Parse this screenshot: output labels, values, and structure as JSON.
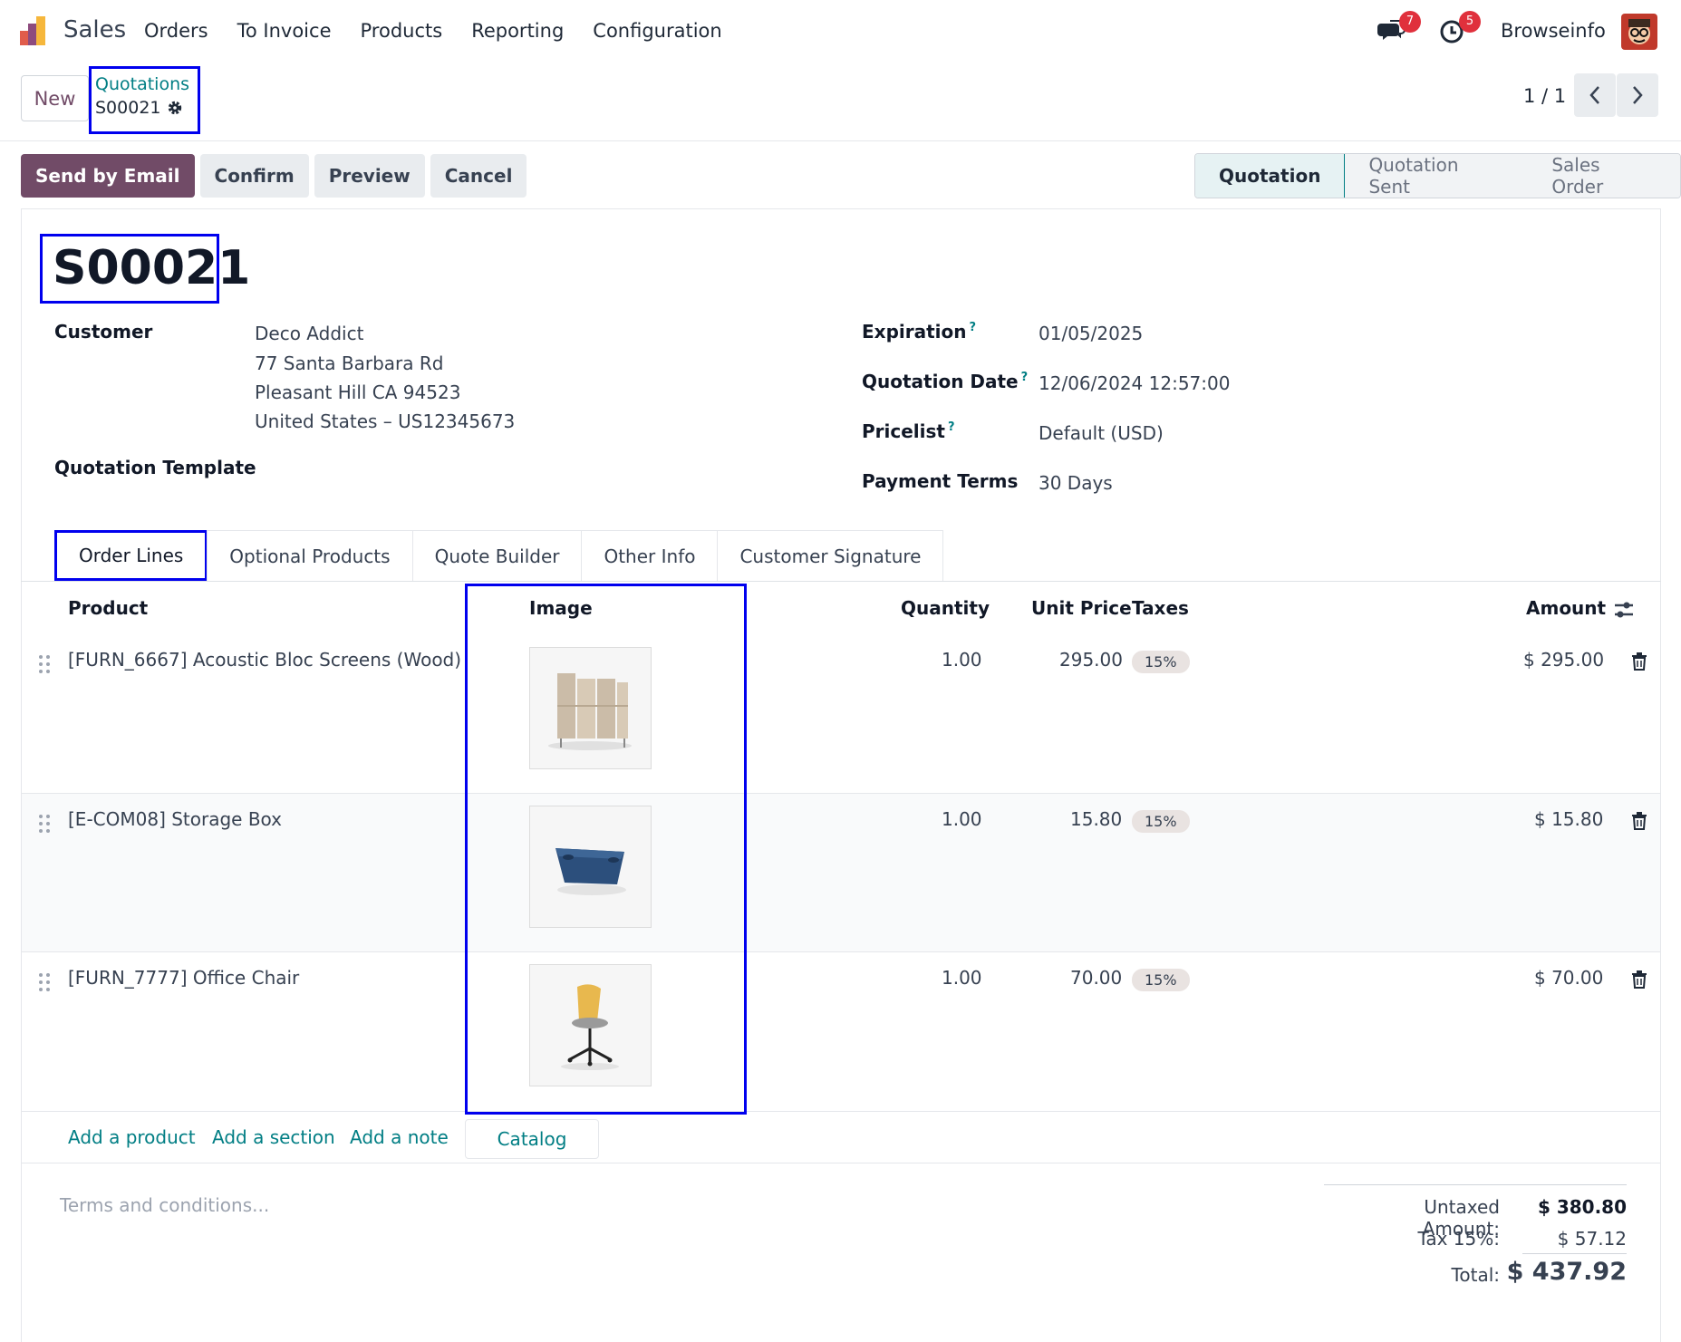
{
  "app": {
    "name": "Sales",
    "company": "Browseinfo"
  },
  "menu": [
    "Orders",
    "To Invoice",
    "Products",
    "Reporting",
    "Configuration"
  ],
  "badges": {
    "messages": "7",
    "activities": "5"
  },
  "control": {
    "new_label": "New",
    "breadcrumb_parent": "Quotations",
    "breadcrumb_current": "S00021",
    "pager": "1 / 1"
  },
  "actions": {
    "send": "Send by Email",
    "confirm": "Confirm",
    "preview": "Preview",
    "cancel": "Cancel"
  },
  "stages": [
    "Quotation",
    "Quotation Sent",
    "Sales Order"
  ],
  "order": {
    "name": "S00021",
    "customer_label": "Customer",
    "customer": [
      "Deco Addict",
      "77 Santa Barbara Rd",
      "Pleasant Hill CA 94523",
      "United States – US12345673"
    ],
    "template_label": "Quotation Template",
    "expiration_label": "Expiration",
    "expiration": "01/05/2025",
    "date_label": "Quotation Date",
    "date": "12/06/2024 12:57:00",
    "pricelist_label": "Pricelist",
    "pricelist": "Default (USD)",
    "terms_label": "Payment Terms",
    "terms": "30 Days",
    "help_mark": "?"
  },
  "tabs": [
    "Order Lines",
    "Optional Products",
    "Quote Builder",
    "Other Info",
    "Customer Signature"
  ],
  "table": {
    "headers": {
      "product": "Product",
      "image": "Image",
      "quantity": "Quantity",
      "unit_price": "Unit Price",
      "taxes": "Taxes",
      "amount": "Amount"
    },
    "rows": [
      {
        "product": "[FURN_6667] Acoustic Bloc Screens (Wood)",
        "quantity": "1.00",
        "unit_price": "295.00",
        "tax": "15%",
        "amount": "$ 295.00",
        "image_icon": "screen-image"
      },
      {
        "product": "[E-COM08] Storage Box",
        "quantity": "1.00",
        "unit_price": "15.80",
        "tax": "15%",
        "amount": "$ 15.80",
        "image_icon": "box-image"
      },
      {
        "product": "[FURN_7777] Office Chair",
        "quantity": "1.00",
        "unit_price": "70.00",
        "tax": "15%",
        "amount": "$ 70.00",
        "image_icon": "chair-image"
      }
    ]
  },
  "add_links": {
    "product": "Add a product",
    "section": "Add a section",
    "note": "Add a note",
    "catalog": "Catalog"
  },
  "footer": {
    "terms_placeholder": "Terms and conditions...",
    "untaxed_label": "Untaxed Amount:",
    "untaxed": "$ 380.80",
    "tax_label": "Tax 15%:",
    "tax": "$ 57.12",
    "total_label": "Total:",
    "total": "$ 437.92"
  },
  "colors": {
    "brand": "#714b67",
    "link": "#017e84",
    "highlight": "#0000ee"
  }
}
